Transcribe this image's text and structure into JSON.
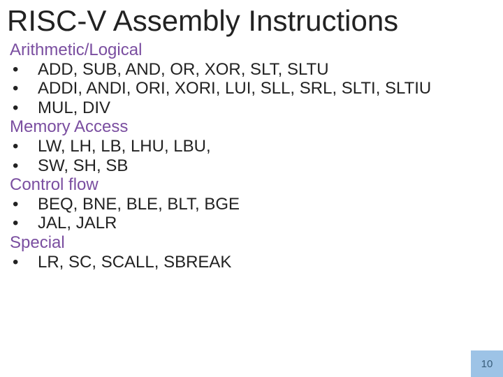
{
  "title": "RISC-V Assembly Instructions",
  "sections": [
    {
      "label": "Arithmetic/Logical",
      "items": [
        "ADD, SUB, AND, OR, XOR, SLT, SLTU",
        "ADDI, ANDI, ORI, XORI, LUI, SLL, SRL, SLTI, SLTIU",
        "MUL, DIV"
      ]
    },
    {
      "label": "Memory Access",
      "items": [
        "LW, LH, LB, LHU, LBU,",
        "SW, SH, SB"
      ]
    },
    {
      "label": "Control flow",
      "items": [
        "BEQ, BNE, BLE, BLT, BGE",
        "JAL, JALR"
      ]
    },
    {
      "label": "Special",
      "items": [
        "LR, SC, SCALL, SBREAK"
      ]
    }
  ],
  "bullet_char": "•",
  "page_number": "10",
  "colors": {
    "category": "#7a4ea0",
    "pagenum_bg": "#9dc3e6",
    "pagenum_fg": "#385d7a"
  }
}
